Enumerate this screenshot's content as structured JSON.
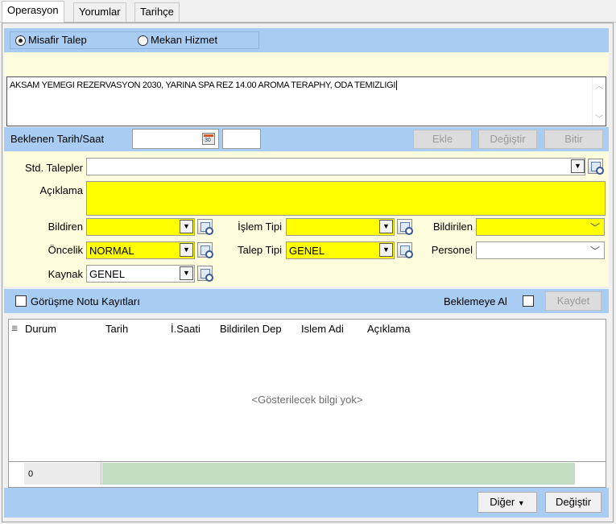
{
  "tabs": [
    {
      "label": "Operasyon",
      "active": true
    },
    {
      "label": "Yorumlar",
      "active": false
    },
    {
      "label": "Tarihçe",
      "active": false
    }
  ],
  "request_type": {
    "options": [
      {
        "label": "Misafir Talep",
        "selected": true
      },
      {
        "label": "Mekan Hizmet",
        "selected": false
      }
    ]
  },
  "notes_text": "AKSAM YEMEGI REZERVASYON 2030, YARINA SPA REZ 14.00 AROMA TERAPHY,  ODA TEMIZLIGI",
  "schedule": {
    "label": "Beklenen Tarih/Saat",
    "date_value": "",
    "time_value": "",
    "buttons": {
      "add": "Ekle",
      "change": "Değiştir",
      "finish": "Bitir"
    }
  },
  "form": {
    "std_requests_label": "Std. Talepler",
    "std_requests_value": "",
    "description_label": "Açıklama",
    "description_value": "",
    "reporter_label": "Bildiren",
    "reporter_value": "",
    "operation_type_label": "İşlem Tipi",
    "operation_type_value": "",
    "reported_to_label": "Bildirilen",
    "reported_to_value": "",
    "priority_label": "Öncelik",
    "priority_value": "NORMAL",
    "request_type_label": "Talep Tipi",
    "request_type_value": "GENEL",
    "staff_label": "Personel",
    "staff_value": "",
    "source_label": "Kaynak",
    "source_value": "GENEL"
  },
  "meeting_bar": {
    "notes_checkbox_label": "Görüşme Notu Kayıtları",
    "notes_checked": false,
    "hold_label": "Beklemeye Al",
    "hold_checked": false,
    "save_label": "Kaydet"
  },
  "grid": {
    "columns": [
      "Durum",
      "Tarih",
      "İ.Saati",
      "Bildirilen Dep",
      "Islem Adi",
      "Açıklama"
    ],
    "empty_message": "<Gösterilecek bilgi yok>",
    "footer_count": "0"
  },
  "bottom_bar": {
    "other_label": "Diğer",
    "change_label": "Değiştir"
  },
  "colors": {
    "band_blue": "#a9cdf2",
    "highlight_yellow": "#ffff00",
    "footer_green": "#c2ddc2"
  }
}
